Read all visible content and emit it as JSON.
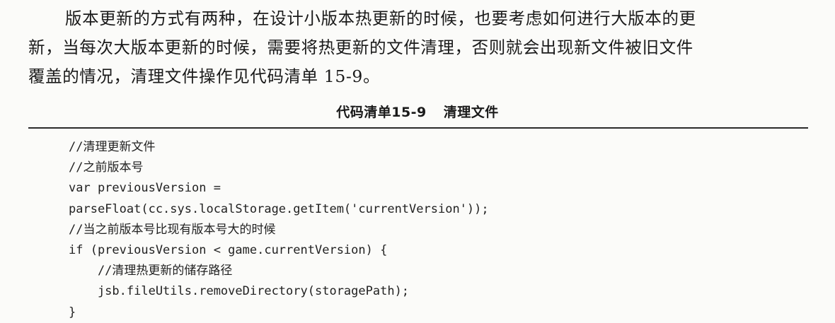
{
  "paragraph": {
    "lines": [
      "版本更新的方式有两种，在设计小版本热更新的时候，也要考虑如何进行大版本的更",
      "新，当每次大版本更新的时候，需要将热更新的文件清理，否则就会出现新文件被旧文件",
      "覆盖的情况，清理文件操作见代码清单 15-9。"
    ]
  },
  "listing": {
    "number": "代码清单15-9",
    "title": "清理文件",
    "code_lines": [
      "//清理更新文件",
      "//之前版本号",
      "var previousVersion =",
      "parseFloat(cc.sys.localStorage.getItem('currentVersion'));",
      "//当之前版本号比现有版本号大的时候",
      "if (previousVersion < game.currentVersion) {",
      "    //清理热更新的储存路径",
      "    jsb.fileUtils.removeDirectory(storagePath);",
      "}"
    ]
  }
}
